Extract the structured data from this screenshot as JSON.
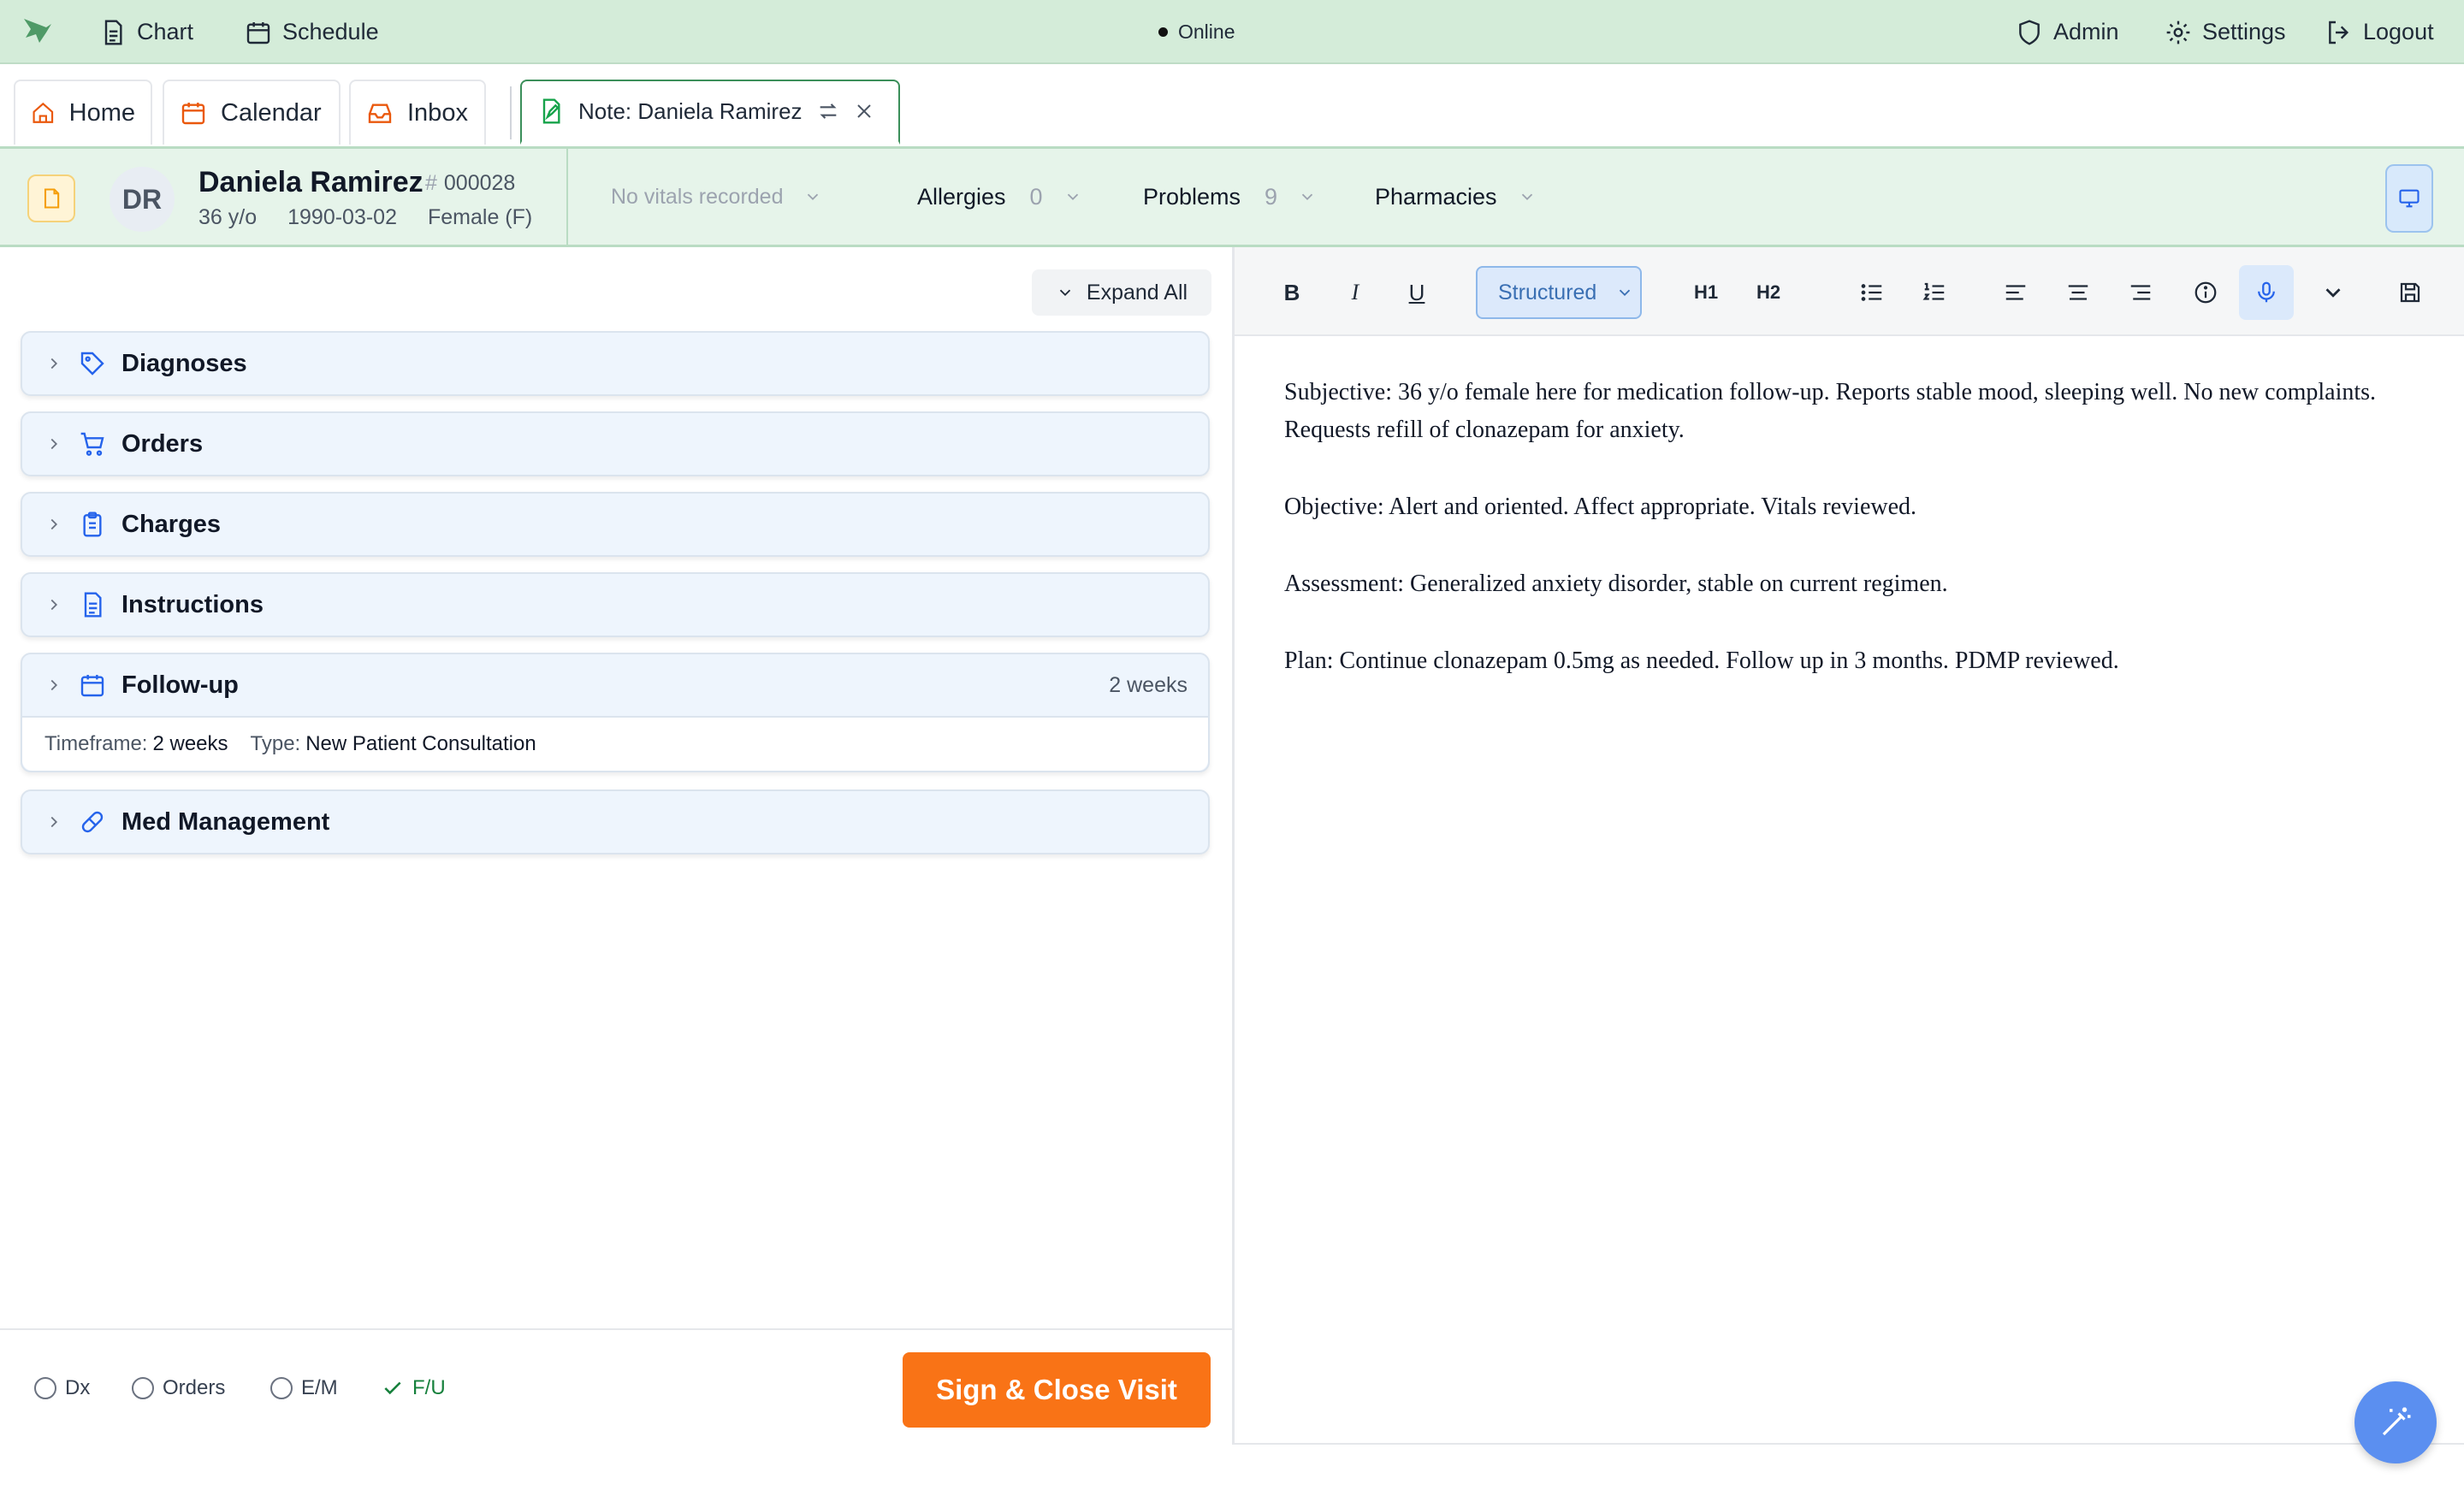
{
  "topbar": {
    "chart": "Chart",
    "schedule": "Schedule",
    "status": "Online",
    "admin": "Admin",
    "settings": "Settings",
    "logout": "Logout"
  },
  "tabs": {
    "home": "Home",
    "calendar": "Calendar",
    "inbox": "Inbox",
    "note": "Note: Daniela Ramirez"
  },
  "patient": {
    "initials": "DR",
    "name": "Daniela Ramirez",
    "mrn_hash": "#",
    "mrn": "000028",
    "age": "36 y/o",
    "dob": "1990-03-02",
    "sex": "Female (F)",
    "vitals": "No vitals recorded",
    "allergies_label": "Allergies",
    "allergies_count": "0",
    "problems_label": "Problems",
    "problems_count": "9",
    "pharmacies_label": "Pharmacies"
  },
  "left": {
    "expand_all": "Expand All",
    "sections": {
      "diagnoses": "Diagnoses",
      "orders": "Orders",
      "charges": "Charges",
      "instructions": "Instructions",
      "followup": "Follow-up",
      "followup_value": "2 weeks",
      "followup_timeframe_label": "Timeframe:",
      "followup_timeframe": "2 weeks",
      "followup_type_label": "Type:",
      "followup_type": "New Patient Consultation",
      "med_management": "Med Management"
    },
    "footer": {
      "dx": "Dx",
      "orders": "Orders",
      "em": "E/M",
      "fu": "F/U",
      "sign": "Sign & Close Visit"
    }
  },
  "editor": {
    "toolbar": {
      "bold": "B",
      "italic": "I",
      "underline": "U",
      "mode": "Structured",
      "h1": "H1",
      "h2": "H2"
    },
    "note": {
      "subjective": "Subjective: 36 y/o female here for medication follow-up. Reports stable mood, sleeping well. No new complaints. Requests refill of clonazepam for anxiety.",
      "objective": "Objective: Alert and oriented. Affect appropriate. Vitals reviewed.",
      "assessment": "Assessment: Generalized anxiety disorder, stable on current regimen.",
      "plan": "Plan: Continue clonazepam 0.5mg as needed. Follow up in 3 months. PDMP reviewed."
    }
  },
  "colors": {
    "topbar_bg": "#d4ecd9",
    "accent_green": "#3b8f5a",
    "primary_orange": "#f97316",
    "section_bg": "#eef5fd",
    "icon_blue": "#2563eb",
    "magic_blue": "#5b8ff0"
  },
  "icons": {
    "logo": "app-logo-icon",
    "chart": "document-icon",
    "schedule": "calendar-icon",
    "admin": "shield-icon",
    "settings": "gear-icon",
    "logout": "logout-icon",
    "home": "home-icon",
    "inbox": "inbox-icon",
    "note": "note-icon",
    "swap": "swap-icon",
    "close": "close-icon",
    "screen": "monitor-icon",
    "mic": "microphone-icon",
    "save": "save-icon",
    "magic": "magic-wand-icon"
  }
}
